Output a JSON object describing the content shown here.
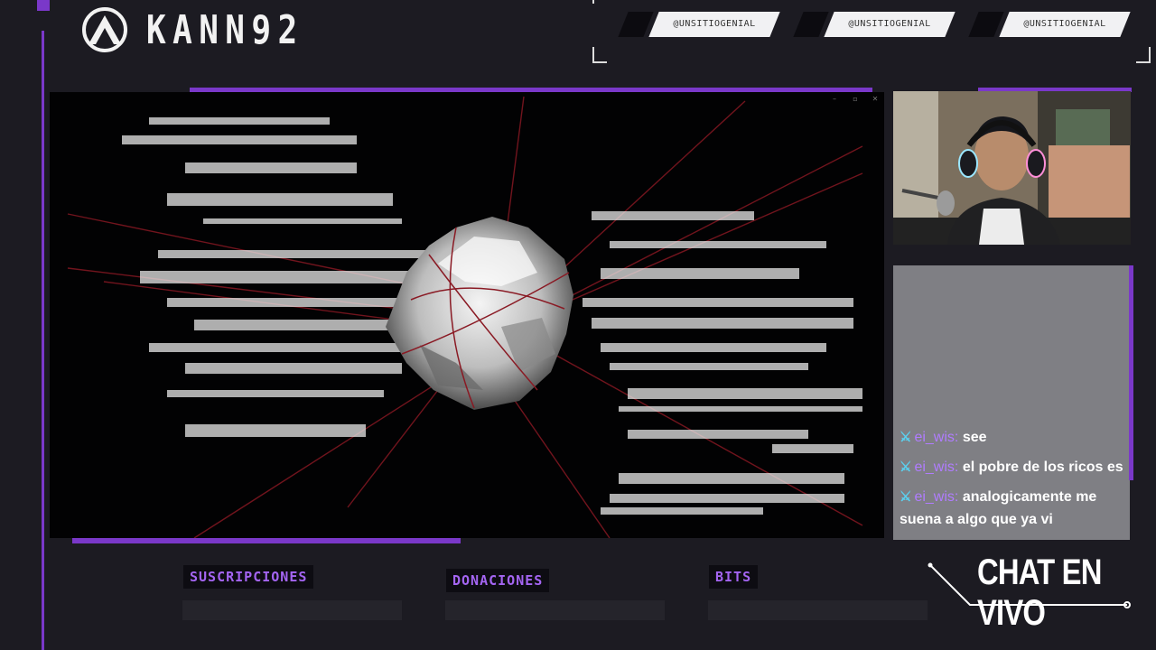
{
  "brand": {
    "name": "KANN92",
    "logo_icon": "kann-logo-icon"
  },
  "socials": [
    {
      "handle": "@UNSITIOGENIAL"
    },
    {
      "handle": "@UNSITIOGENIAL"
    },
    {
      "handle": "@UNSITIOGENIAL"
    }
  ],
  "game_window": {
    "controls": [
      "–",
      "▫",
      "✕"
    ]
  },
  "chat": {
    "messages": [
      {
        "user": "ei_wis",
        "separator": ":",
        "text": "see"
      },
      {
        "user": "ei_wis",
        "separator": ":",
        "text": "el pobre de los ricos es"
      },
      {
        "user": "ei_wis",
        "separator": ":",
        "text": "analogicamente me suena a algo que ya vi"
      }
    ]
  },
  "stats": {
    "subscriptions_label": "SUSCRIPCIONES",
    "donations_label": "DONACIONES",
    "bits_label": "BITS"
  },
  "chat_live_label": "CHAT EN VIVO",
  "colors": {
    "accent": "#7a38c9",
    "background": "#1c1b22",
    "username": "#b07cff"
  }
}
